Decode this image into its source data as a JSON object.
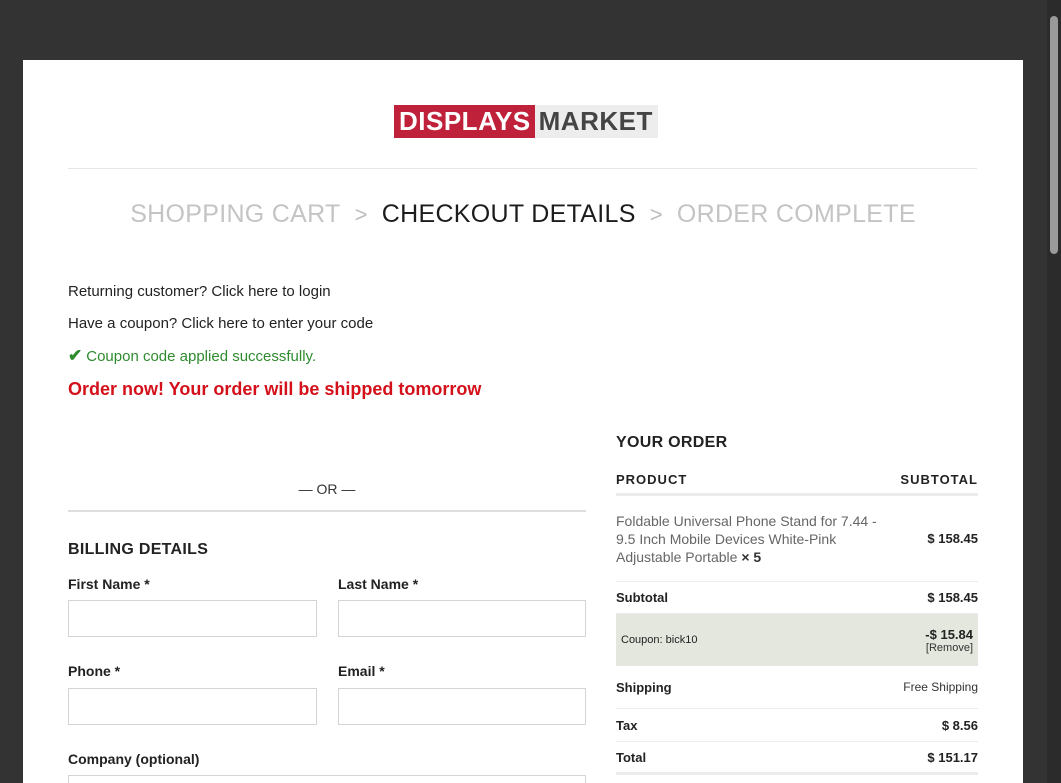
{
  "logo": {
    "part1": "DISPLAYS",
    "part2": "MARKET"
  },
  "steps": [
    {
      "label": "SHOPPING CART",
      "active": false
    },
    {
      "label": "CHECKOUT DETAILS",
      "active": true
    },
    {
      "label": "ORDER COMPLETE",
      "active": false
    }
  ],
  "step_separator": ">",
  "notices": {
    "returning": "Returning customer? Click here to login",
    "coupon": "Have a coupon? Click here to enter your code",
    "success": "Coupon code applied successfully.",
    "promo": "Order now! Your order will be shipped tomorrow"
  },
  "or_text": "— OR —",
  "billing": {
    "title": "BILLING DETAILS",
    "first_name_label": "First Name *",
    "last_name_label": "Last Name *",
    "phone_label": "Phone *",
    "email_label": "Email *",
    "company_label": "Company (optional)",
    "first_name_value": "",
    "last_name_value": "",
    "phone_value": "",
    "email_value": ""
  },
  "order": {
    "title": "YOUR ORDER",
    "col_product": "PRODUCT",
    "col_subtotal": "SUBTOTAL",
    "item_name": "Foldable Universal Phone Stand for 7.44 - 9.5 Inch Mobile Devices White-Pink Adjustable Portable",
    "item_qty": "× 5",
    "item_total": "$ 158.45",
    "subtotal_label": "Subtotal",
    "subtotal_value": "$ 158.45",
    "coupon_label": "Coupon: bick10",
    "coupon_value": "-$ 15.84",
    "coupon_remove": "[Remove]",
    "shipping_label": "Shipping",
    "shipping_value": "Free Shipping",
    "tax_label": "Tax",
    "tax_value": "$ 8.56",
    "total_label": "Total",
    "total_value": "$ 151.17"
  },
  "colors": {
    "background": "#333333",
    "brand_red": "#c0213a",
    "promo_red": "#d4111b",
    "success_green": "#2e8b2e",
    "coupon_row": "#e3e7dd"
  },
  "icons": {
    "success": "check-icon",
    "step_separator": "chevron-right-icon"
  }
}
